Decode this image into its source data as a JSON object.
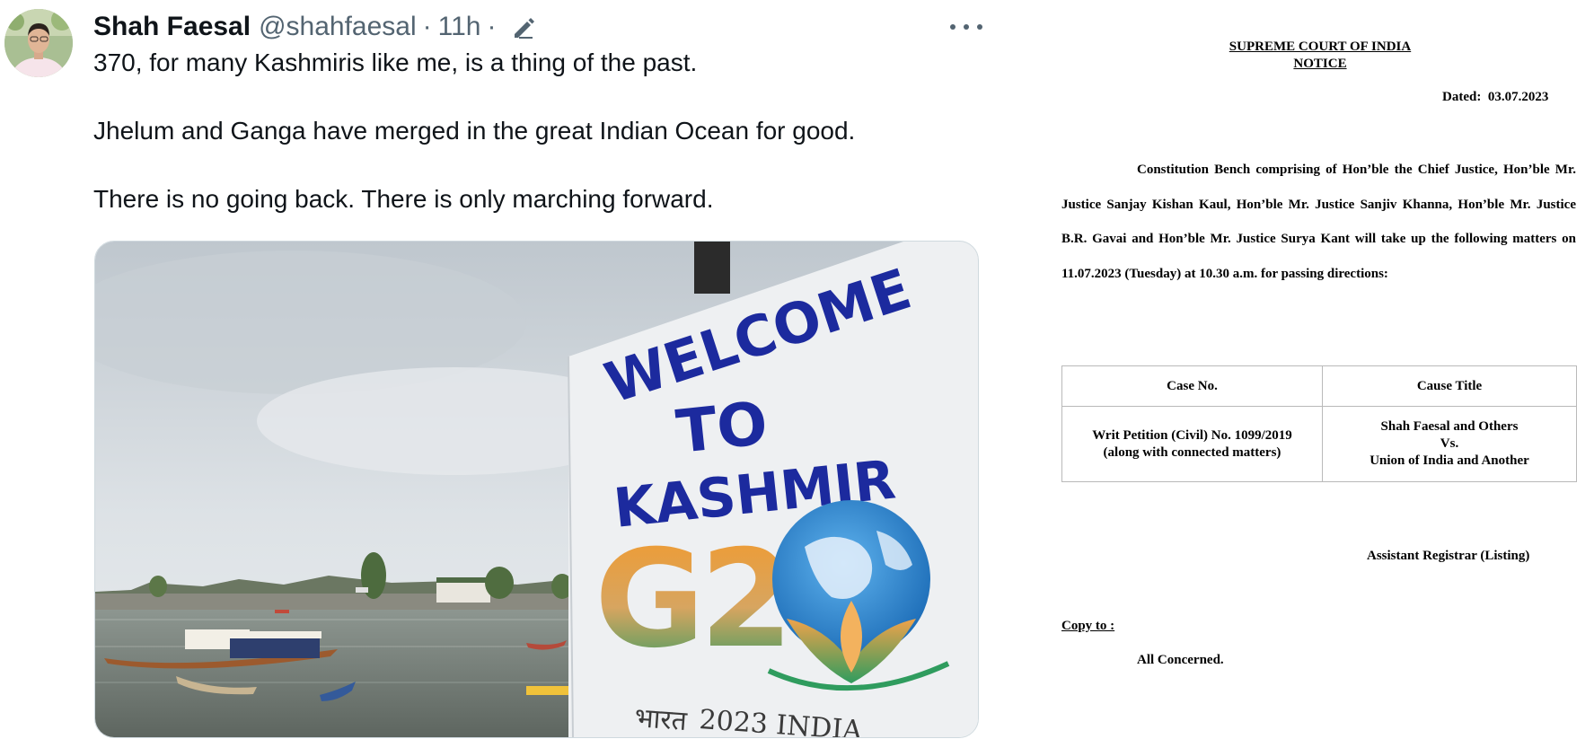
{
  "tweet": {
    "author_name": "Shah Faesal",
    "handle": "@shahfaesal",
    "separator": "·",
    "time": "11h",
    "icons": {
      "edit": "pencil-edited-icon",
      "more": "more-dots-icon"
    },
    "lines": [
      "370, for many Kashmiris like me, is a thing of the past.",
      "Jhelum and Ganga have merged in the great Indian Ocean for good.",
      "There is no going back. There is only marching forward."
    ],
    "media": {
      "sign_words": [
        "WELCOME",
        "TO",
        "KASHMIR"
      ],
      "logo_text": "G20",
      "footer_hindi": "भारत",
      "footer_text": "2023 INDIA"
    }
  },
  "notice": {
    "court": "SUPREME COURT OF INDIA",
    "heading": "NOTICE",
    "dated_label": "Dated:",
    "dated_value": "03.07.2023",
    "body": "Constitution Bench comprising of Hon’ble the Chief Justice, Hon’ble Mr. Justice Sanjay Kishan Kaul, Hon’ble Mr. Justice Sanjiv Khanna, Hon’ble Mr. Justice B.R. Gavai and Hon’ble Mr. Justice Surya Kant will take up the following matters on 11.07.2023 (Tuesday) at 10.30 a.m. for passing directions:",
    "table": {
      "headers": [
        "Case No.",
        "Cause Title"
      ],
      "case_line1": "Writ Petition (Civil) No. 1099/2019",
      "case_line2": "(along with connected matters)",
      "title_line1": "Shah Faesal and Others",
      "title_line2": "Vs.",
      "title_line3": "Union of India and Another"
    },
    "signatory": "Assistant Registrar (Listing)",
    "copy_to": "Copy to :",
    "recipients": "All Concerned."
  },
  "colors": {
    "text": "#0f1419",
    "secondary": "#536471",
    "sign_blue": "#1c2a9e",
    "g20_orange": "#f0932b",
    "g20_green": "#2e9c63",
    "globe_blue": "#2a87d0"
  }
}
